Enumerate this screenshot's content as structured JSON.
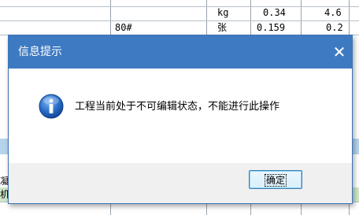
{
  "background_sheet": {
    "row1": {
      "unit": "kg",
      "value1": "0.34",
      "value2": "4.6"
    },
    "row2": {
      "name": "80#",
      "unit": "张",
      "value1": "0.159",
      "value2": "0.2"
    },
    "row_left_fragments": [
      "凝",
      "机"
    ]
  },
  "dialog": {
    "title": "信息提示",
    "message": "工程当前处于不可编辑状态，不能进行此操作",
    "ok_label": "确定",
    "close_glyph": "✕"
  },
  "colors": {
    "titlebar": "#3e7ac2",
    "info_icon": "#1e5fb4"
  }
}
